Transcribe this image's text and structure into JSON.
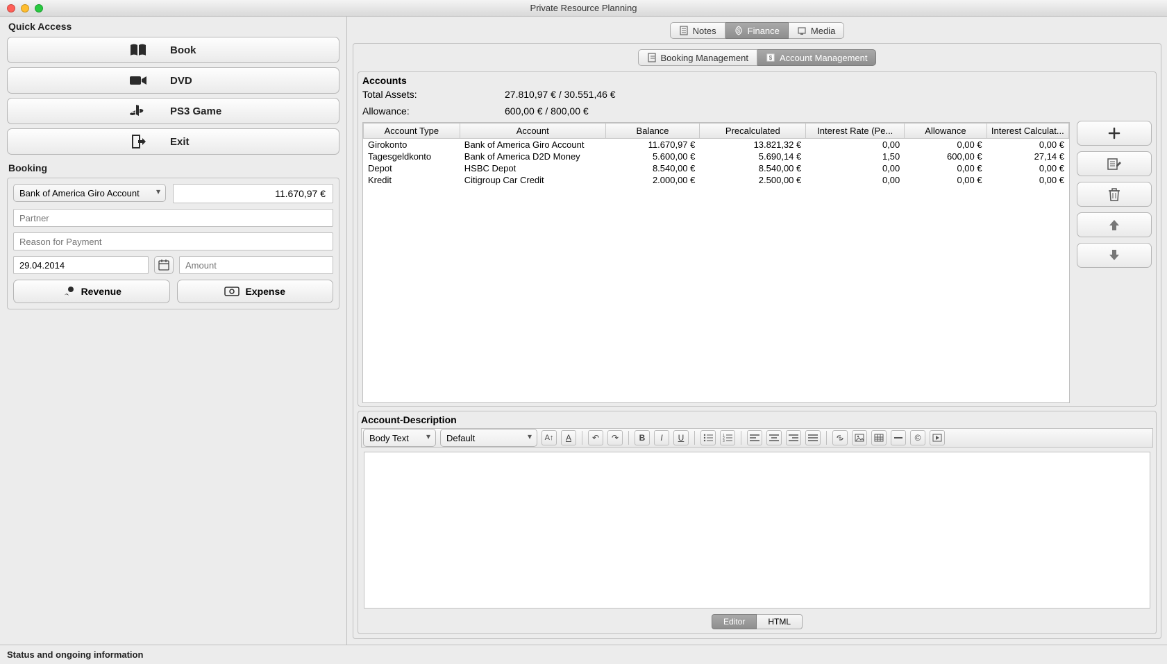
{
  "window": {
    "title": "Private Resource Planning"
  },
  "quick_access": {
    "title": "Quick Access",
    "buttons": {
      "book": "Book",
      "dvd": "DVD",
      "ps3": "PS3 Game",
      "exit": "Exit"
    }
  },
  "booking": {
    "title": "Booking",
    "account_select": "Bank of America Giro Account",
    "balance_display": "11.670,97 €",
    "partner_placeholder": "Partner",
    "reason_placeholder": "Reason for Payment",
    "date_value": "29.04.2014",
    "amount_placeholder": "Amount",
    "revenue_label": "Revenue",
    "expense_label": "Expense"
  },
  "top_tabs": {
    "notes": "Notes",
    "finance": "Finance",
    "media": "Media"
  },
  "sub_tabs": {
    "booking_mgmt": "Booking Management",
    "account_mgmt": "Account Management"
  },
  "accounts": {
    "title": "Accounts",
    "total_assets_label": "Total Assets:",
    "total_assets_value": "27.810,97 €   /   30.551,46 €",
    "allowance_label": "Allowance:",
    "allowance_value": "600,00 €   /   800,00 €",
    "headers": {
      "type": "Account Type",
      "account": "Account",
      "balance": "Balance",
      "precalc": "Precalculated",
      "rate": "Interest Rate (Pe...",
      "allowance": "Allowance",
      "calc": "Interest Calculat..."
    },
    "rows": [
      {
        "type": "Girokonto",
        "account": "Bank of America Giro Account",
        "balance": "11.670,97 €",
        "precalc": "13.821,32 €",
        "rate": "0,00",
        "allowance": "0,00 €",
        "calc": "0,00 €"
      },
      {
        "type": "Tagesgeldkonto",
        "account": "Bank of America D2D Money",
        "balance": "5.600,00 €",
        "precalc": "5.690,14 €",
        "rate": "1,50",
        "allowance": "600,00 €",
        "calc": "27,14 €"
      },
      {
        "type": "Depot",
        "account": "HSBC Depot",
        "balance": "8.540,00 €",
        "precalc": "8.540,00 €",
        "rate": "0,00",
        "allowance": "0,00 €",
        "calc": "0,00 €"
      },
      {
        "type": "Kredit",
        "account": "Citigroup Car Credit",
        "balance": "2.000,00 €",
        "precalc": "2.500,00 €",
        "rate": "0,00",
        "allowance": "0,00 €",
        "calc": "0,00 €"
      }
    ]
  },
  "description": {
    "title": "Account-Description"
  },
  "rte": {
    "style": "Body Text",
    "font": "Default"
  },
  "view_toggle": {
    "editor": "Editor",
    "html": "HTML"
  },
  "statusbar": "Status and ongoing information"
}
